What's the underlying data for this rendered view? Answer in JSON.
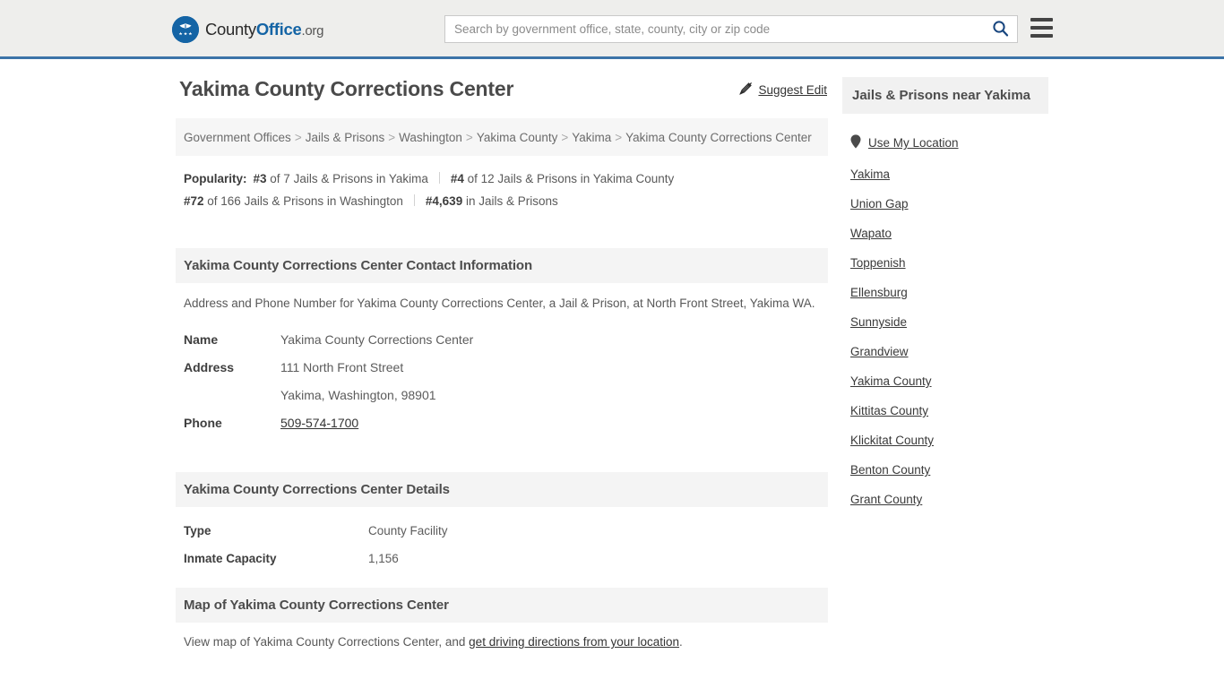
{
  "header": {
    "logo": {
      "icon": "eagle-shield-logo",
      "part1": "County",
      "part2": "Office",
      "part3": ".org"
    },
    "search": {
      "placeholder": "Search by government office, state, county, city or zip code",
      "value": "",
      "icon": "search-icon"
    },
    "menu_icon": "hamburger-menu-icon",
    "accent_color": "#1464a5",
    "border_color": "#3c74a8",
    "background_color": "#eeeeec"
  },
  "main": {
    "title": "Yakima County Corrections Center",
    "breadcrumb": {
      "separator": ">",
      "items": [
        "Government Offices",
        "Jails & Prisons",
        "Washington",
        "Yakima County",
        "Yakima"
      ],
      "current": "Yakima County Corrections Center"
    },
    "popularity": {
      "label": "Popularity:",
      "items": [
        {
          "rank": "#3",
          "rest": " of 7 Jails & Prisons in Yakima"
        },
        {
          "rank": "#4",
          "rest": " of 12 Jails & Prisons in Yakima County"
        },
        {
          "rank": "#72",
          "rest": " of 166 Jails & Prisons in Washington"
        },
        {
          "rank": "#4,639",
          "rest": " in Jails & Prisons"
        }
      ]
    },
    "contact": {
      "heading": "Yakima County Corrections Center Contact Information",
      "intro": "Address and Phone Number for Yakima County Corrections Center, a Jail & Prison, at North Front Street, Yakima WA.",
      "suggest_edit": {
        "label": "Suggest Edit",
        "icon": "pencil-edit-icon"
      },
      "rows": [
        {
          "key": "Name",
          "value": "Yakima County Corrections Center"
        },
        {
          "key": "Address",
          "value": "111 North Front Street"
        },
        {
          "key": "",
          "value": "Yakima, Washington, 98901"
        }
      ],
      "phone_key": "Phone",
      "phone_value": "509-574-1700"
    },
    "details": {
      "heading": "Yakima County Corrections Center Details",
      "rows": [
        {
          "key": "Type",
          "value": "County Facility"
        },
        {
          "key": "Inmate Capacity",
          "value": "1,156"
        }
      ]
    },
    "map": {
      "heading": "Map of Yakima County Corrections Center",
      "text_before": "View map of Yakima County Corrections Center, and ",
      "link": "get driving directions from your location",
      "text_after": "."
    }
  },
  "sidebar": {
    "heading": "Jails & Prisons near Yakima",
    "locate": {
      "label": "Use My Location",
      "icon": "map-pin-icon"
    },
    "links": [
      "Yakima",
      "Union Gap",
      "Wapato",
      "Toppenish",
      "Ellensburg",
      "Sunnyside",
      "Grandview",
      "Yakima County",
      "Kittitas County",
      "Klickitat County",
      "Benton County",
      "Grant County"
    ]
  }
}
